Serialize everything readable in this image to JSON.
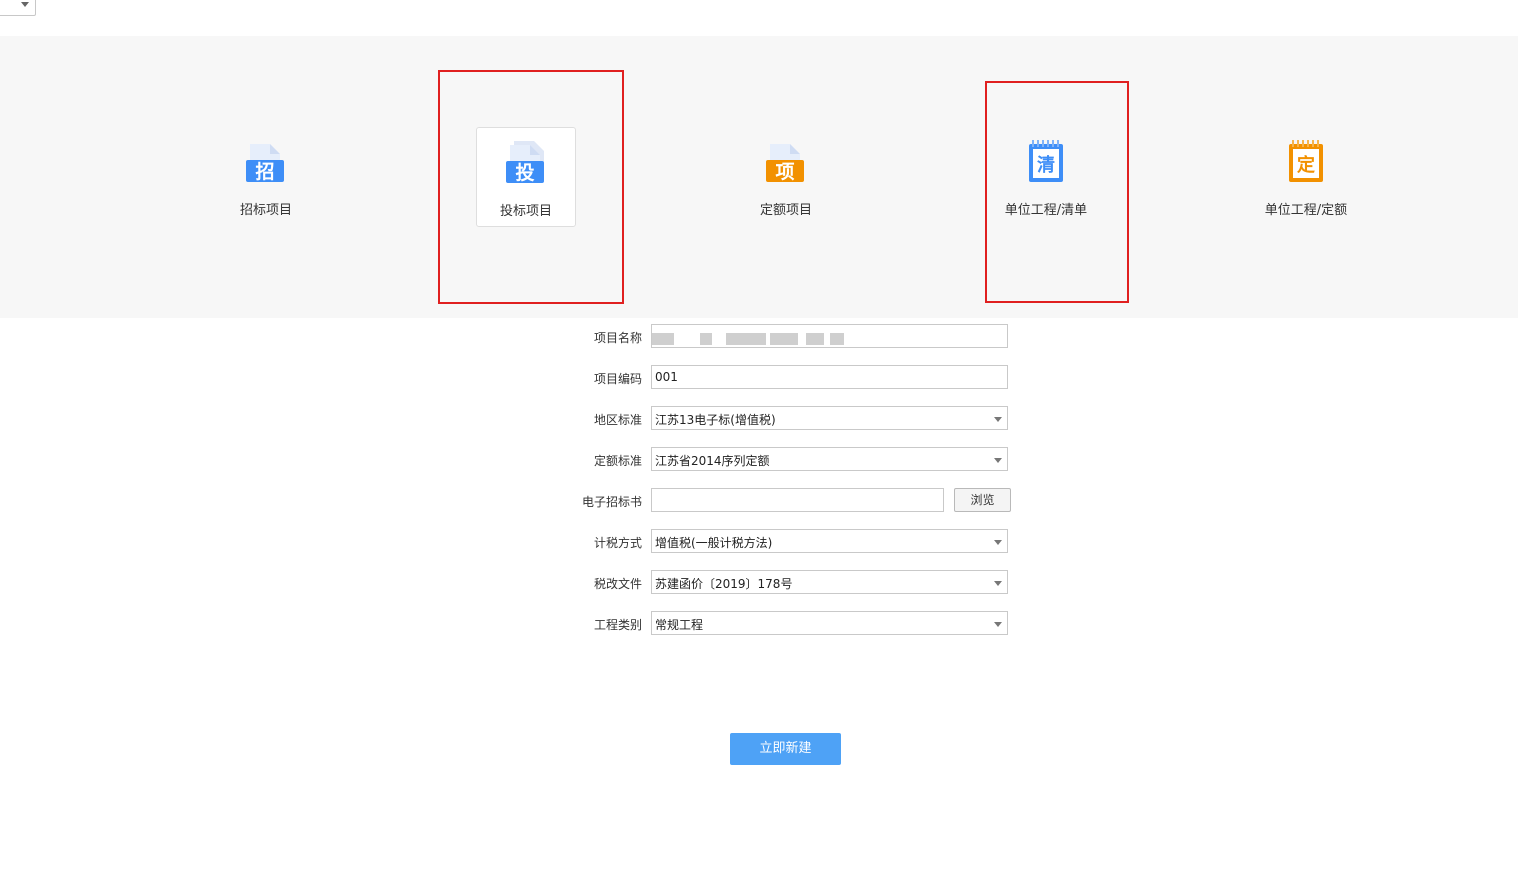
{
  "project_types": [
    {
      "label": "招标项目",
      "icon_char": "招",
      "icon": "bid-invite-doc-icon",
      "color": "#3e8ef7"
    },
    {
      "label": "投标项目",
      "icon_char": "投",
      "icon": "bid-submit-doc-icon",
      "color": "#3e8ef7"
    },
    {
      "label": "定额项目",
      "icon_char": "项",
      "icon": "quota-project-doc-icon",
      "color": "#f29100"
    },
    {
      "label": "单位工程/清单",
      "icon_char": "清",
      "icon": "unit-bill-notebook-icon",
      "color": "#3e8ef7"
    },
    {
      "label": "单位工程/定额",
      "icon_char": "定",
      "icon": "unit-quota-notebook-icon",
      "color": "#f29100"
    }
  ],
  "form": {
    "project_name": {
      "label": "项目名称",
      "value": ""
    },
    "project_code": {
      "label": "项目编码",
      "value": "001"
    },
    "region_standard": {
      "label": "地区标准",
      "value": "江苏13电子标(增值税)"
    },
    "quota_standard": {
      "label": "定额标准",
      "value": "江苏省2014序列定额"
    },
    "e_bid_file": {
      "label": "电子招标书",
      "value": "",
      "browse_label": "浏览"
    },
    "tax_method": {
      "label": "计税方式",
      "value": "增值税(一般计税方法)"
    },
    "tax_reform_doc": {
      "label": "税改文件",
      "value": "苏建函价〔2019〕178号"
    },
    "project_category": {
      "label": "工程类别",
      "value": "常规工程"
    }
  },
  "create_button": "立即新建",
  "highlight_color": "#e02020",
  "accent_color": "#4ea2f6"
}
